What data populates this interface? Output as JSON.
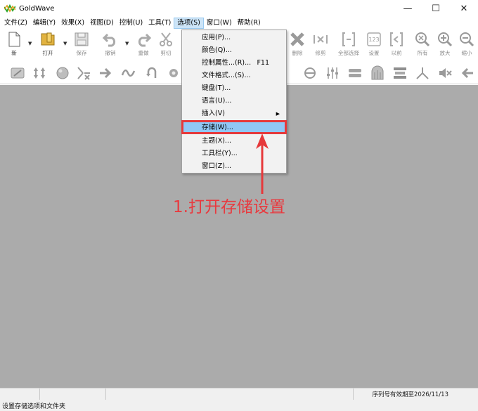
{
  "window": {
    "title": "GoldWave",
    "minimize": "—",
    "maximize": "☐",
    "close": "✕"
  },
  "menu": [
    {
      "label": "文件(Z)"
    },
    {
      "label": "编辑(Y)"
    },
    {
      "label": "效果(X)"
    },
    {
      "label": "视图(D)"
    },
    {
      "label": "控制(U)"
    },
    {
      "label": "工具(T)"
    },
    {
      "label": "选项(S)",
      "active": true
    },
    {
      "label": "窗口(W)"
    },
    {
      "label": "帮助(R)"
    }
  ],
  "toolbar": {
    "new": "新",
    "open": "打开",
    "save": "保存",
    "undo": "撤销",
    "redo": "重做",
    "cut": "剪切",
    "delete": "删除",
    "trim": "修剪",
    "select_all": "全部选择",
    "set": "设置",
    "previous": "以前",
    "all": "所有",
    "zoom_in": "放大",
    "zoom_out": "缩小"
  },
  "options_menu": [
    {
      "label": "应用(P)..."
    },
    {
      "label": "颜色(Q)..."
    },
    {
      "label": "控制属性...(R)...",
      "shortcut": "F11"
    },
    {
      "label": "文件格式...(S)..."
    },
    {
      "label": "键盘(T)..."
    },
    {
      "label": "语言(U)..."
    },
    {
      "label": "插入(V)",
      "submenu": "▶"
    },
    {
      "label": "存储(W)...",
      "highlighted": true
    },
    {
      "label": "主题(X)..."
    },
    {
      "label": "工具栏(Y)..."
    },
    {
      "label": "窗口(Z)..."
    }
  ],
  "annotation": "1.打开存储设置",
  "status": {
    "serial": "序列号有效期至2026/11/13",
    "hint": "设置存储选项和文件夹"
  },
  "colors": {
    "workspace": "#ababab",
    "annotation_red": "#e6393b",
    "menu_highlight": "#90c8f6"
  }
}
